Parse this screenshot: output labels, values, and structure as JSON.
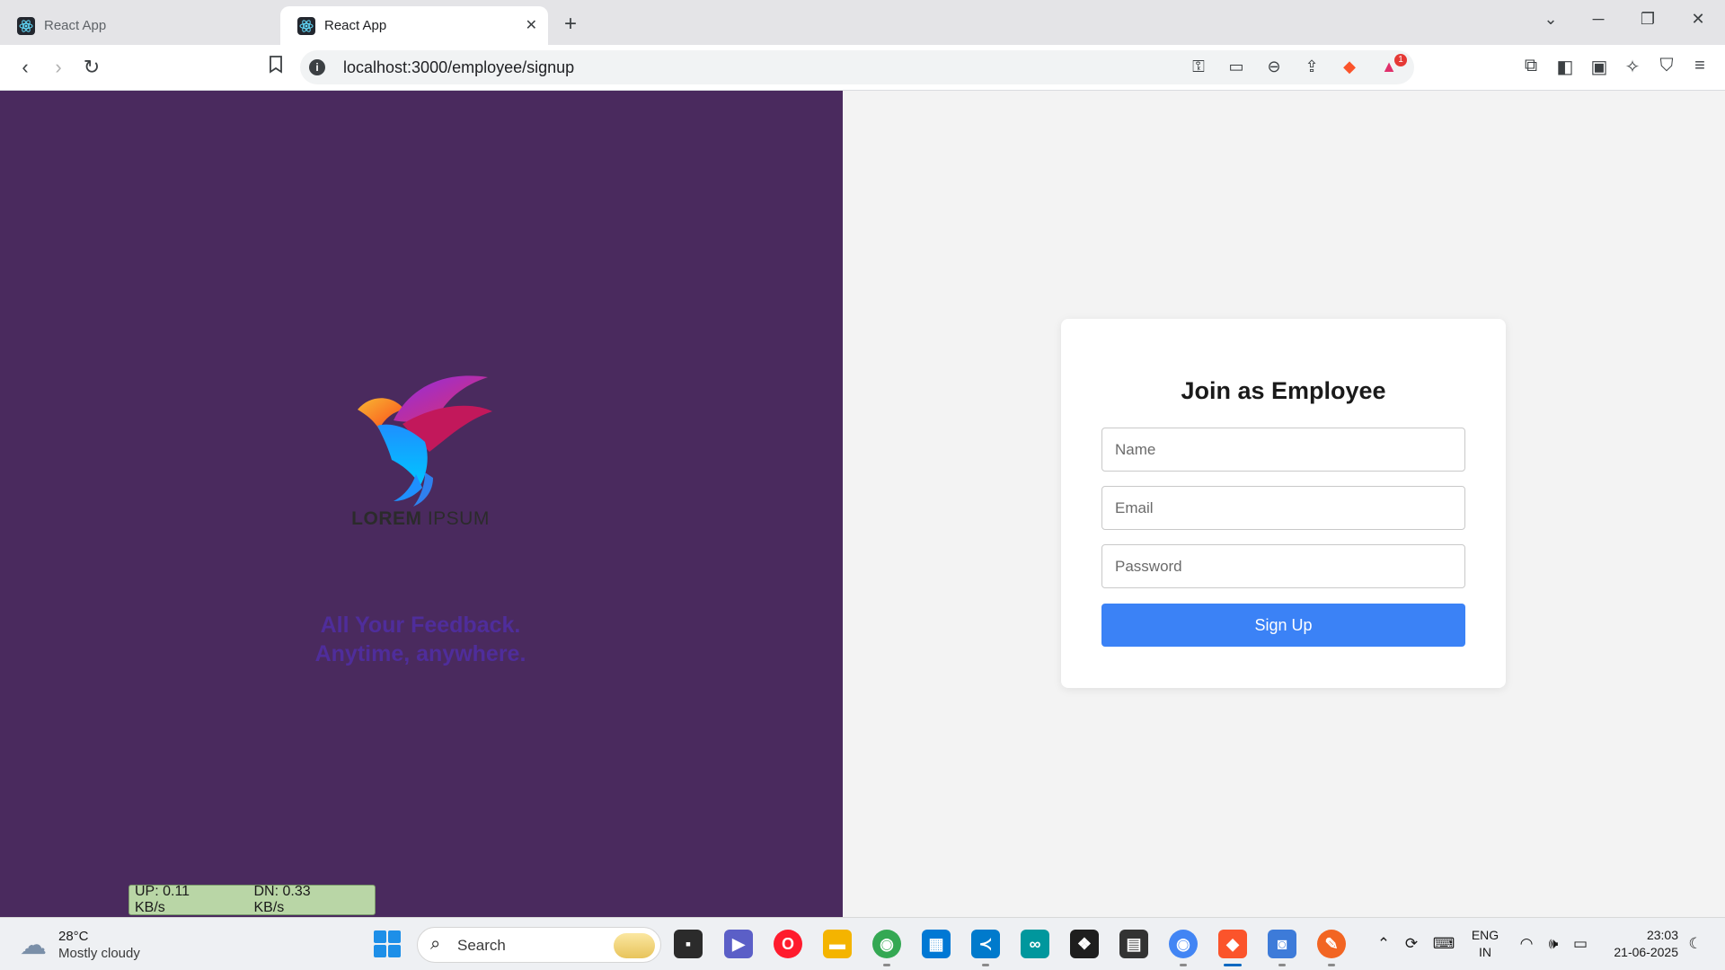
{
  "browser": {
    "tabs": [
      {
        "title": "React App",
        "active": false
      },
      {
        "title": "React App",
        "active": true
      }
    ],
    "url": "localhost:3000/employee/signup",
    "tab_close_icon": "close-icon",
    "new_tab_icon": "plus-icon",
    "notification_badge": "1"
  },
  "branding": {
    "logo_word1": "LOREM",
    "logo_word2": "IPSUM",
    "tagline_line1": "All Your Feedback.",
    "tagline_line2": "Anytime, anywhere.",
    "panel_color": "#4a2a5e",
    "tagline_color": "#4f2d9b"
  },
  "signup_form": {
    "heading": "Join as Employee",
    "name_placeholder": "Name",
    "email_placeholder": "Email",
    "password_placeholder": "Password",
    "submit_label": "Sign Up",
    "button_color": "#3b82f6"
  },
  "net_speed": {
    "up": "UP: 0.11 KB/s",
    "down": "DN: 0.33 KB/s"
  },
  "taskbar": {
    "weather_temp": "28°C",
    "weather_desc": "Mostly cloudy",
    "search_label": "Search",
    "language_line1": "ENG",
    "language_line2": "IN",
    "time": "23:03",
    "date": "21-06-2025"
  }
}
